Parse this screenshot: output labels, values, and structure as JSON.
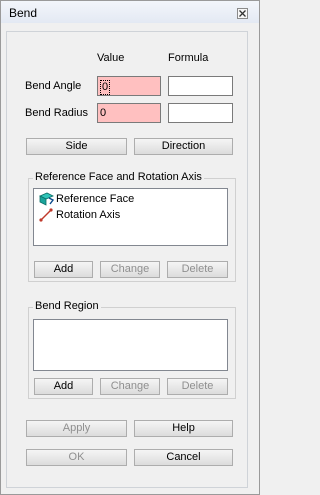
{
  "window": {
    "title": "Bend"
  },
  "columns": {
    "value": "Value",
    "formula": "Formula"
  },
  "fields": [
    {
      "label": "Bend Angle",
      "value": "0",
      "formula": ""
    },
    {
      "label": "Bend Radius",
      "value": "0",
      "formula": ""
    }
  ],
  "buttons": {
    "side": "Side",
    "direction": "Direction"
  },
  "reference_group": {
    "title": "Reference Face and Rotation Axis",
    "items": [
      {
        "label": "Reference Face",
        "icon": "reference-face-icon"
      },
      {
        "label": "Rotation Axis",
        "icon": "rotation-axis-icon"
      }
    ],
    "add": "Add",
    "change": "Change",
    "delete": "Delete"
  },
  "bend_region_group": {
    "title": "Bend Region",
    "add": "Add",
    "change": "Change",
    "delete": "Delete"
  },
  "footer": {
    "apply": "Apply",
    "help": "Help",
    "ok": "OK",
    "cancel": "Cancel"
  },
  "colors": {
    "invalid_field": "#ffc0c0",
    "accent_teal": "#1aa39a",
    "axis_red": "#c0392b"
  }
}
